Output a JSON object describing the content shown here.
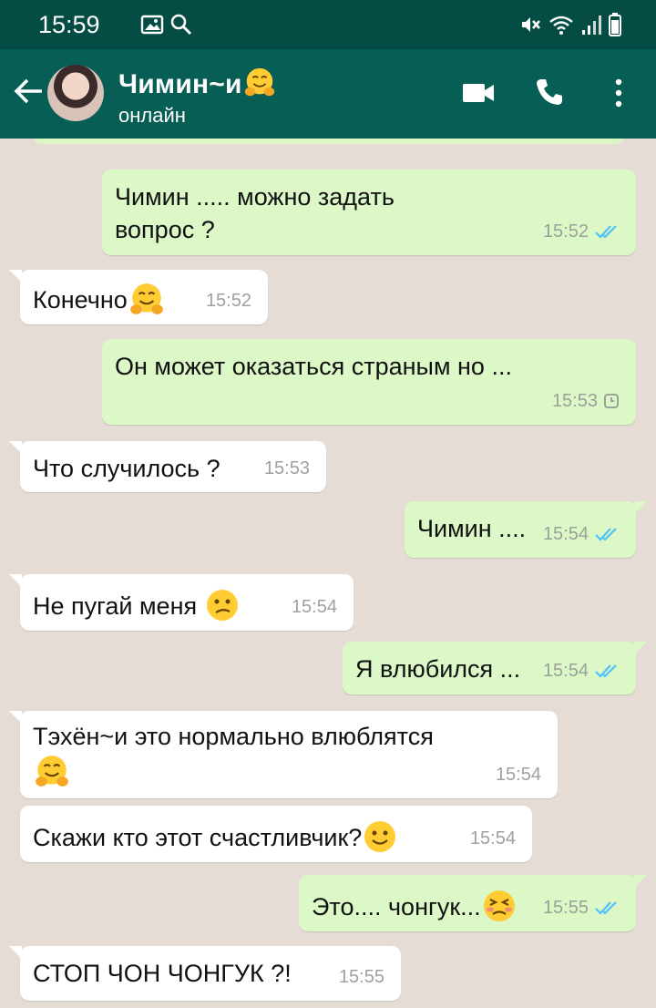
{
  "status_bar": {
    "time": "15:59"
  },
  "header": {
    "contact_name": "Чимин~и",
    "contact_status": "онлайн"
  },
  "messages": [
    {
      "direction": "out",
      "text": "Чимин ..... можно задать вопрос ?",
      "time": "15:52",
      "status": "read"
    },
    {
      "direction": "in",
      "text": "Конечно",
      "emoji": "hug",
      "time": "15:52"
    },
    {
      "direction": "out",
      "text": "Он может оказаться страным но ...",
      "time": "15:53",
      "status": "pending"
    },
    {
      "direction": "in",
      "text": "Что случилось ?",
      "time": "15:53"
    },
    {
      "direction": "out",
      "text": "Чимин ....",
      "time": "15:54",
      "status": "read"
    },
    {
      "direction": "in",
      "text": "Не пугай меня",
      "emoji": "confused",
      "time": "15:54"
    },
    {
      "direction": "out",
      "text": "Я влюбился ...",
      "time": "15:54",
      "status": "read"
    },
    {
      "direction": "in",
      "text": "Тэхён~и это нормально влюблятся",
      "emoji": "hug",
      "time": "15:54"
    },
    {
      "direction": "in",
      "text": "Скажи кто этот счастливчик?",
      "emoji": "smile",
      "time": "15:54"
    },
    {
      "direction": "out",
      "text": "Это.... чонгук...",
      "emoji": "persevering",
      "time": "15:55",
      "status": "read"
    },
    {
      "direction": "in",
      "text": "СТОП ЧОН ЧОНГУК ?!",
      "time": "15:55"
    }
  ],
  "colors": {
    "header": "#075e54",
    "status_bar": "#054d44",
    "outgoing": "#dcf8c6",
    "incoming": "#ffffff",
    "read_ticks": "#4fc3f7"
  },
  "icons": [
    "image-icon",
    "search-icon",
    "mute-icon",
    "wifi-icon",
    "signal-icon",
    "battery-icon",
    "back-arrow-icon",
    "video-call-icon",
    "phone-icon",
    "more-options-icon"
  ]
}
